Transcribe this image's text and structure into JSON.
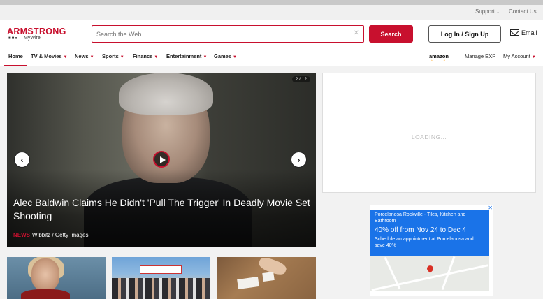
{
  "utility": {
    "support_label": "Support",
    "contact_label": "Contact Us"
  },
  "header": {
    "logo_main": "ARMSTRONG",
    "logo_sub": "MyWire",
    "search_placeholder": "Search the Web",
    "search_button": "Search",
    "login_button": "Log In / Sign Up",
    "email_label": "Email"
  },
  "nav": {
    "items": [
      {
        "label": "Home",
        "has_dropdown": false,
        "active": true
      },
      {
        "label": "TV & Movies",
        "has_dropdown": true
      },
      {
        "label": "News",
        "has_dropdown": true
      },
      {
        "label": "Sports",
        "has_dropdown": true
      },
      {
        "label": "Finance",
        "has_dropdown": true
      },
      {
        "label": "Entertainment",
        "has_dropdown": true
      },
      {
        "label": "Games",
        "has_dropdown": true
      }
    ],
    "right": {
      "amazon_label": "amazon",
      "manage_exp": "Manage EXP",
      "my_account": "My Account"
    }
  },
  "hero": {
    "counter": "2 / 12",
    "headline": "Alec Baldwin Claims He Didn't 'Pull The Trigger' In Deadly Movie Set Shooting",
    "source_tag": "NEWS",
    "source": "Wibbitz / Getty Images"
  },
  "ad": {
    "loading": "LOADING...",
    "title": "Porcelanosa Rockville - Tiles, Kitchen and Bathroom",
    "offer": "40% off from Nov 24 to Dec 4",
    "desc": "Schedule an appointment at Porcelanosa and save 40%"
  },
  "colors": {
    "brand": "#c8102e",
    "ad_blue": "#1a73e8"
  }
}
